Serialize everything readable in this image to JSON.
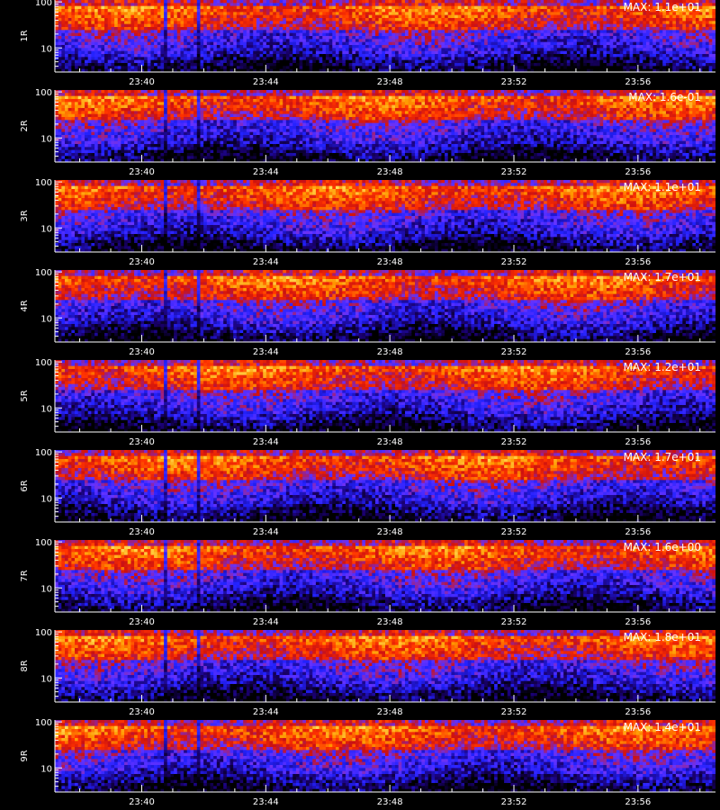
{
  "chart_data": {
    "type": "heatmap",
    "x_tick_labels": [
      "23:40",
      "23:44",
      "23:48",
      "23:52",
      "23:56"
    ],
    "x_tick_minutes": [
      40,
      44,
      48,
      52,
      56
    ],
    "x_range_minutes": [
      37.2,
      58.5
    ],
    "y_scale": "log",
    "y_range": [
      3,
      110
    ],
    "y_tick_labels": [
      "10",
      "100"
    ],
    "y_tick_values": [
      10,
      100
    ],
    "colormap": [
      "#000000",
      "#1a0070",
      "#2222ff",
      "#6633ff",
      "#cc1111",
      "#ff3300",
      "#ff9900",
      "#ffdd55"
    ],
    "panels": [
      {
        "label": "1R",
        "max": "MAX: 1.1e+01"
      },
      {
        "label": "2R",
        "max": "MAX: 1.6e-01"
      },
      {
        "label": "3R",
        "max": "MAX: 1.1e+01"
      },
      {
        "label": "4R",
        "max": "MAX: 1.7e+01"
      },
      {
        "label": "5R",
        "max": "MAX: 1.2e+01"
      },
      {
        "label": "6R",
        "max": "MAX: 1.7e+01"
      },
      {
        "label": "7R",
        "max": "MAX: 1.6e+00"
      },
      {
        "label": "8R",
        "max": "MAX: 1.8e+01"
      },
      {
        "label": "9R",
        "max": "MAX: 1.4e+01"
      }
    ]
  }
}
